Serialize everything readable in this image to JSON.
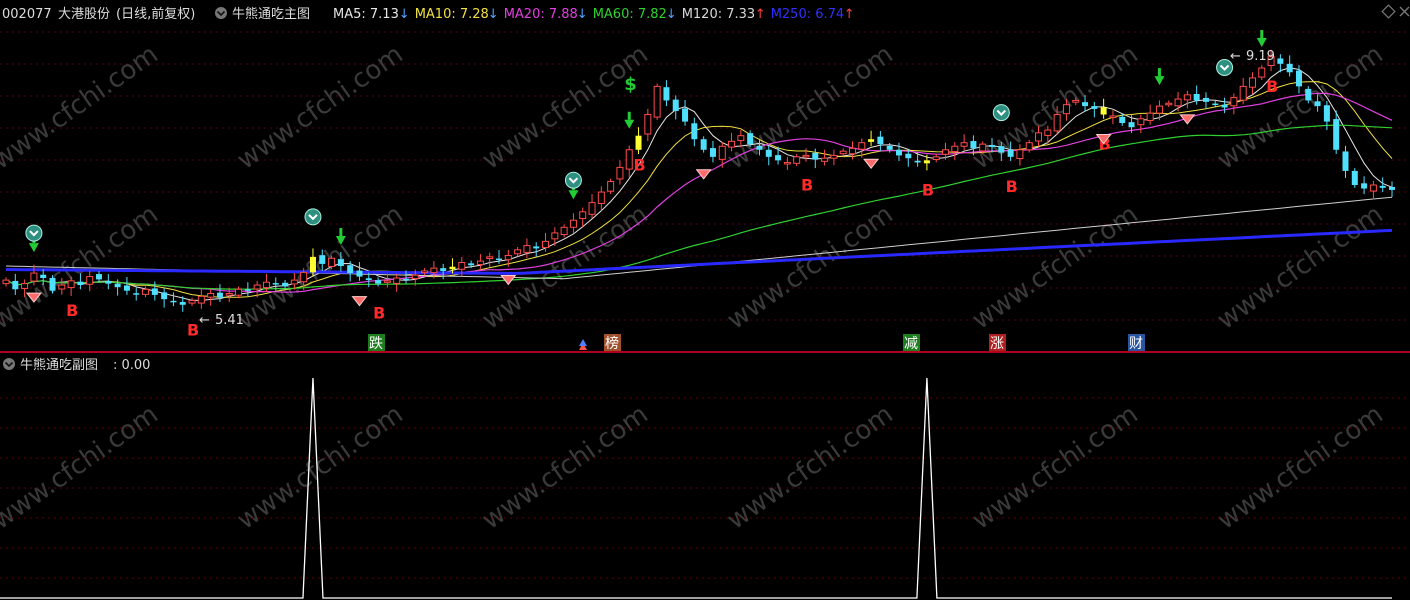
{
  "header": {
    "stock_code": "002077",
    "stock_name": "大港股份",
    "period": "(日线,前复权)",
    "main_indicator": "牛熊通吃主图",
    "ma": [
      {
        "label": "MA5: ",
        "value": "7.13",
        "arrow": "↓",
        "color": "#e6e6e6",
        "arrow_color": "#4fa3ff"
      },
      {
        "label": "MA10: ",
        "value": "7.28",
        "arrow": "↓",
        "color": "#f0e040",
        "arrow_color": "#4fa3ff"
      },
      {
        "label": "MA20: ",
        "value": "7.88",
        "arrow": "↓",
        "color": "#e040e0",
        "arrow_color": "#4fa3ff"
      },
      {
        "label": "MA60: ",
        "value": "7.82",
        "arrow": "↓",
        "color": "#30d030",
        "arrow_color": "#4fa3ff"
      },
      {
        "label": "M120: ",
        "value": "7.33",
        "arrow": "↑",
        "color": "#d8d8d8",
        "arrow_color": "#ff4040"
      },
      {
        "label": "M250: ",
        "value": "6.74",
        "arrow": "↑",
        "color": "#3030ff",
        "arrow_color": "#ff4040"
      }
    ]
  },
  "sub_panel": {
    "title": "牛熊通吃副图",
    "value_text": ": 0.00"
  },
  "annotations": {
    "low_price": "5.41",
    "high_price": "9.19",
    "buy_marker": "B",
    "dollar_marker": "$"
  },
  "event_labels": [
    {
      "text": "跌",
      "bg": "#1e7d1e"
    },
    {
      "text": "榜",
      "bg": "#a0522d"
    },
    {
      "text": "减",
      "bg": "#1e7d1e"
    },
    {
      "text": "涨",
      "bg": "#b02020"
    },
    {
      "text": "财",
      "bg": "#2a55a0"
    }
  ],
  "watermark": "www.cfchi.com",
  "colors": {
    "up": "#ff4b4b",
    "down": "#4fe0ff",
    "flat": "#ffff33",
    "axis_red": "#b0001a",
    "grid": "#6a0010",
    "buy": "#ff2a2a"
  },
  "chart_data": [
    {
      "type": "candlestick",
      "title": "牛熊通吃主图",
      "x_count": 150,
      "ylim": [
        5.0,
        9.4
      ],
      "close": [
        5.85,
        5.72,
        5.8,
        5.95,
        5.88,
        5.7,
        5.78,
        5.84,
        5.78,
        5.9,
        5.86,
        5.8,
        5.75,
        5.7,
        5.66,
        5.72,
        5.64,
        5.58,
        5.54,
        5.5,
        5.56,
        5.62,
        5.66,
        5.6,
        5.66,
        5.72,
        5.7,
        5.78,
        5.82,
        5.8,
        5.76,
        5.85,
        5.96,
        6.18,
        6.08,
        6.16,
        6.05,
        5.95,
        5.9,
        5.85,
        5.8,
        5.84,
        5.88,
        5.86,
        5.92,
        5.98,
        6.02,
        5.98,
        6.04,
        6.1,
        6.06,
        6.12,
        6.18,
        6.14,
        6.2,
        6.28,
        6.34,
        6.3,
        6.4,
        6.52,
        6.6,
        6.7,
        6.82,
        6.95,
        7.1,
        7.25,
        7.45,
        7.7,
        7.9,
        8.2,
        8.6,
        8.4,
        8.25,
        8.1,
        7.85,
        7.7,
        7.6,
        7.75,
        7.82,
        7.9,
        7.78,
        7.7,
        7.6,
        7.55,
        7.52,
        7.6,
        7.62,
        7.56,
        7.58,
        7.62,
        7.68,
        7.72,
        7.8,
        7.85,
        7.78,
        7.7,
        7.62,
        7.58,
        7.52,
        7.55,
        7.6,
        7.7,
        7.75,
        7.8,
        7.72,
        7.78,
        7.74,
        7.66,
        7.6,
        7.7,
        7.8,
        7.94,
        7.98,
        8.2,
        8.34,
        8.4,
        8.32,
        8.28,
        8.2,
        8.18,
        8.08,
        8.02,
        8.14,
        8.22,
        8.32,
        8.36,
        8.42,
        8.48,
        8.4,
        8.38,
        8.34,
        8.3,
        8.44,
        8.6,
        8.72,
        8.86,
        9.02,
        8.92,
        8.8,
        8.6,
        8.4,
        8.32,
        8.1,
        7.7,
        7.4,
        7.2,
        7.15,
        7.2,
        7.16,
        7.13
      ],
      "ma5": 7.13,
      "ma10": 7.28,
      "ma20": 7.88,
      "ma60": 7.82,
      "ma120": 7.33,
      "ma250": 6.74,
      "buy_signals": [
        7,
        20,
        40,
        68,
        86,
        99,
        108,
        118,
        136
      ],
      "price_low": 5.41,
      "price_high": 9.19
    },
    {
      "type": "line",
      "title": "牛熊通吃副图",
      "ylim": [
        0,
        1
      ],
      "spikes_at": [
        33,
        99
      ],
      "value": 0.0
    }
  ]
}
